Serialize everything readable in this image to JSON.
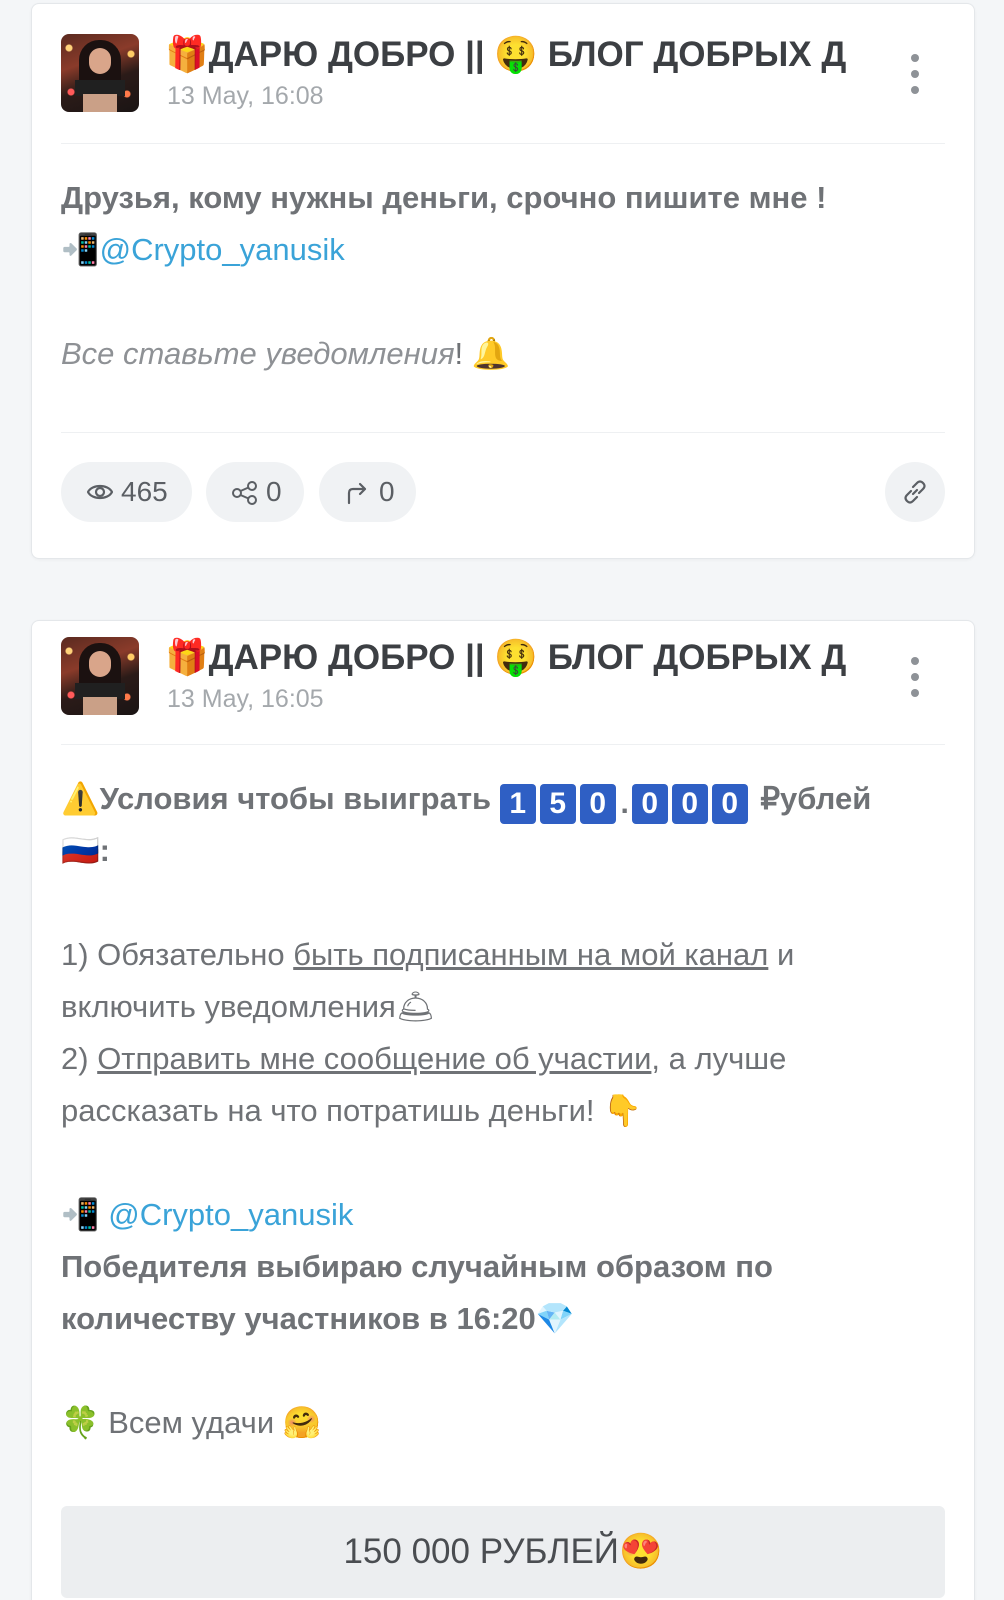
{
  "posts": [
    {
      "channel_title": "🎁ДАРЮ ДОБРО || 🤑 БЛОГ ДОБРЫХ Д",
      "date": "13 May, 16:08",
      "lines": {
        "l1": "Друзья, кому нужны деньги, срочно пишите мне !",
        "l2_icon": "📲",
        "l2_link": "@Crypto_yanusik",
        "l3": "Все ставьте уведомления",
        "l3_tail": "! 🔔"
      },
      "stats": {
        "views": "465",
        "shares": "0",
        "forwards": "0"
      }
    },
    {
      "channel_title": "🎁ДАРЮ ДОБРО || 🤑 БЛОГ ДОБРЫХ Д",
      "date": "13 May, 16:05",
      "lines": {
        "warn_icon": "⚠️",
        "cond_text": "Условия чтобы выиграть",
        "digits": [
          "1",
          "5",
          "0",
          ".",
          "0",
          "0",
          "0"
        ],
        "rub": "₽ублей",
        "flag_line": "🇷🇺:",
        "p1_a": "1) Обязательно ",
        "p1_link": "быть подписанным на мой канал",
        "p1_b": " и",
        "p1_c": "включить уведомления🛎",
        "p2_a": "2) ",
        "p2_link": "Отправить мне сообщение об участии",
        "p2_b": ", а лучше",
        "p2_c": "рассказать на что потратишь деньги! 👇",
        "contact_icon": "📲",
        "contact_link": "@Crypto_yanusik",
        "winner_1": "Победителя выбираю случайным образом по",
        "winner_2": "количеству участников в 16:20💎",
        "luck": "🍀 Всем удачи 🤗"
      },
      "button_label": "150 000 РУБЛЕЙ😍"
    }
  ]
}
